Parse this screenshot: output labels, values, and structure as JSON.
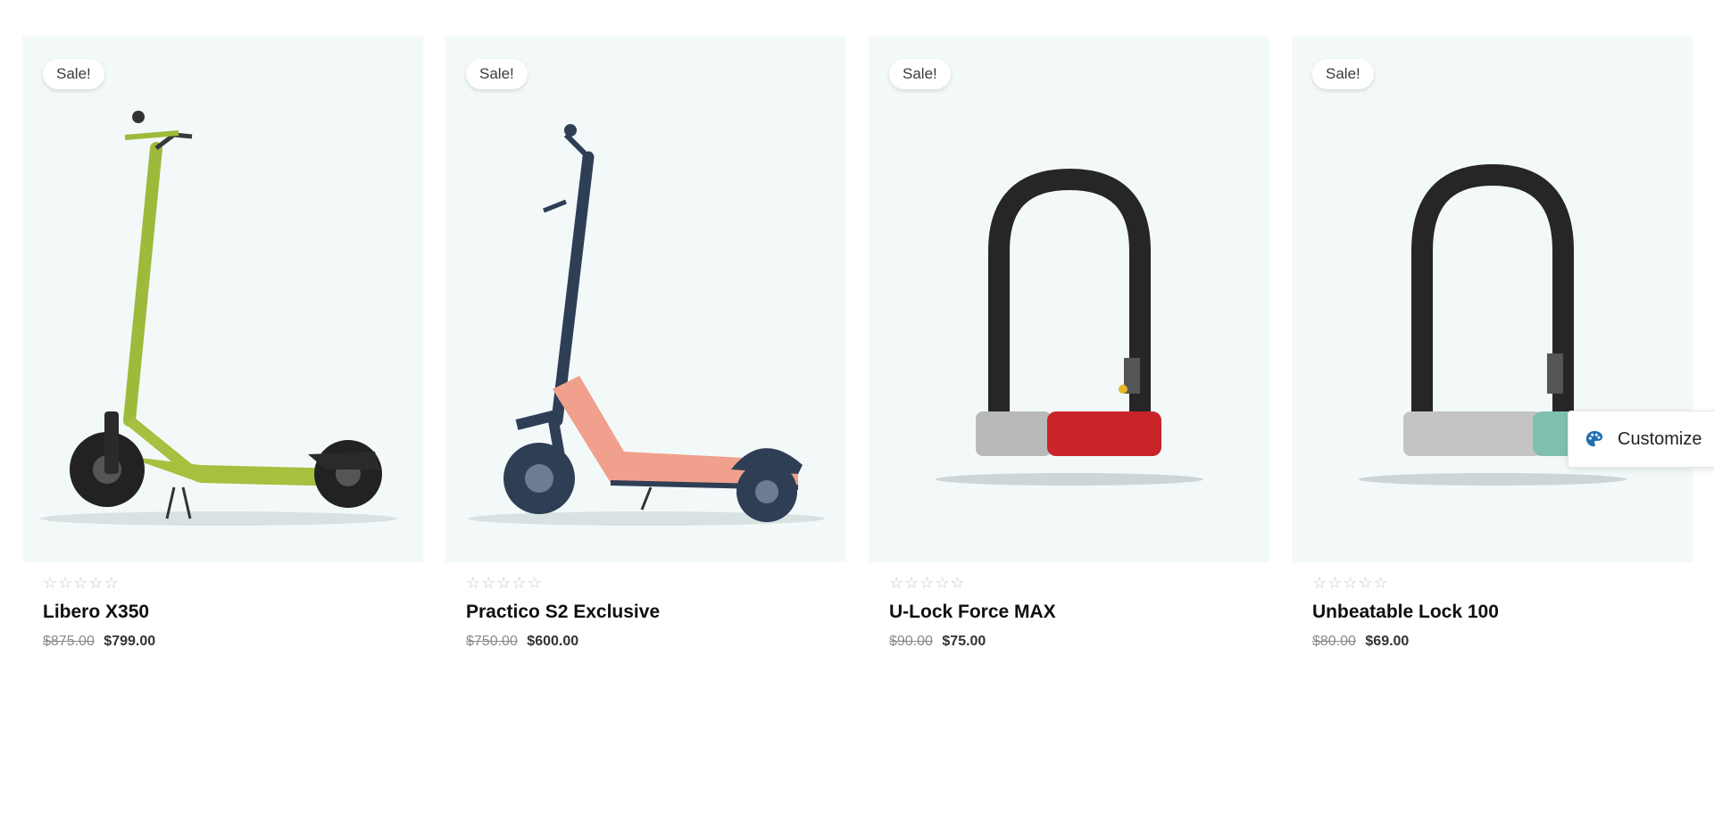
{
  "products": [
    {
      "badge": "Sale!",
      "rating": "☆☆☆☆☆",
      "name": "Libero X350",
      "old_price": "$875.00",
      "new_price": "$799.00"
    },
    {
      "badge": "Sale!",
      "rating": "☆☆☆☆☆",
      "name": "Practico S2 Exclusive",
      "old_price": "$750.00",
      "new_price": "$600.00"
    },
    {
      "badge": "Sale!",
      "rating": "☆☆☆☆☆",
      "name": "U-Lock Force MAX",
      "old_price": "$90.00",
      "new_price": "$75.00"
    },
    {
      "badge": "Sale!",
      "rating": "☆☆☆☆☆",
      "name": "Unbeatable Lock 100",
      "old_price": "$80.00",
      "new_price": "$69.00"
    }
  ],
  "customize": {
    "label": "Customize",
    "icon": "palette-icon"
  },
  "colors": {
    "accent": "#2271b1",
    "card_bg": "#f3f9f9"
  }
}
